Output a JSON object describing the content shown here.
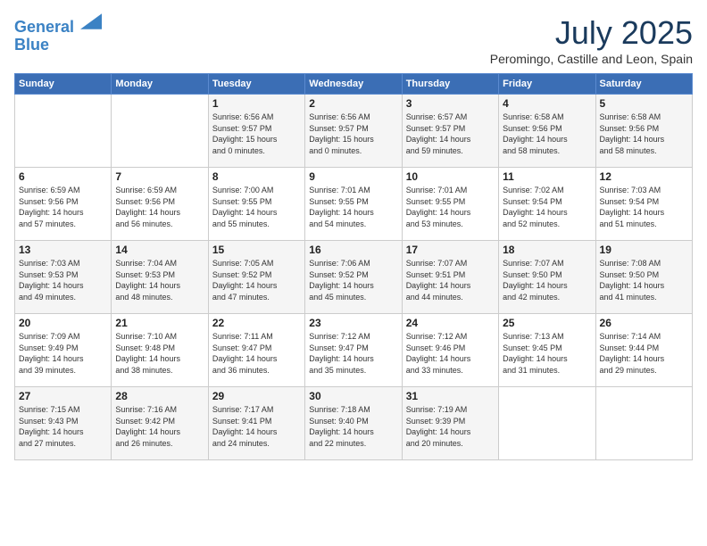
{
  "logo": {
    "line1": "General",
    "line2": "Blue"
  },
  "title": "July 2025",
  "location": "Peromingo, Castille and Leon, Spain",
  "days_of_week": [
    "Sunday",
    "Monday",
    "Tuesday",
    "Wednesday",
    "Thursday",
    "Friday",
    "Saturday"
  ],
  "weeks": [
    [
      {
        "day": "",
        "info": ""
      },
      {
        "day": "",
        "info": ""
      },
      {
        "day": "1",
        "info": "Sunrise: 6:56 AM\nSunset: 9:57 PM\nDaylight: 15 hours\nand 0 minutes."
      },
      {
        "day": "2",
        "info": "Sunrise: 6:56 AM\nSunset: 9:57 PM\nDaylight: 15 hours\nand 0 minutes."
      },
      {
        "day": "3",
        "info": "Sunrise: 6:57 AM\nSunset: 9:57 PM\nDaylight: 14 hours\nand 59 minutes."
      },
      {
        "day": "4",
        "info": "Sunrise: 6:58 AM\nSunset: 9:56 PM\nDaylight: 14 hours\nand 58 minutes."
      },
      {
        "day": "5",
        "info": "Sunrise: 6:58 AM\nSunset: 9:56 PM\nDaylight: 14 hours\nand 58 minutes."
      }
    ],
    [
      {
        "day": "6",
        "info": "Sunrise: 6:59 AM\nSunset: 9:56 PM\nDaylight: 14 hours\nand 57 minutes."
      },
      {
        "day": "7",
        "info": "Sunrise: 6:59 AM\nSunset: 9:56 PM\nDaylight: 14 hours\nand 56 minutes."
      },
      {
        "day": "8",
        "info": "Sunrise: 7:00 AM\nSunset: 9:55 PM\nDaylight: 14 hours\nand 55 minutes."
      },
      {
        "day": "9",
        "info": "Sunrise: 7:01 AM\nSunset: 9:55 PM\nDaylight: 14 hours\nand 54 minutes."
      },
      {
        "day": "10",
        "info": "Sunrise: 7:01 AM\nSunset: 9:55 PM\nDaylight: 14 hours\nand 53 minutes."
      },
      {
        "day": "11",
        "info": "Sunrise: 7:02 AM\nSunset: 9:54 PM\nDaylight: 14 hours\nand 52 minutes."
      },
      {
        "day": "12",
        "info": "Sunrise: 7:03 AM\nSunset: 9:54 PM\nDaylight: 14 hours\nand 51 minutes."
      }
    ],
    [
      {
        "day": "13",
        "info": "Sunrise: 7:03 AM\nSunset: 9:53 PM\nDaylight: 14 hours\nand 49 minutes."
      },
      {
        "day": "14",
        "info": "Sunrise: 7:04 AM\nSunset: 9:53 PM\nDaylight: 14 hours\nand 48 minutes."
      },
      {
        "day": "15",
        "info": "Sunrise: 7:05 AM\nSunset: 9:52 PM\nDaylight: 14 hours\nand 47 minutes."
      },
      {
        "day": "16",
        "info": "Sunrise: 7:06 AM\nSunset: 9:52 PM\nDaylight: 14 hours\nand 45 minutes."
      },
      {
        "day": "17",
        "info": "Sunrise: 7:07 AM\nSunset: 9:51 PM\nDaylight: 14 hours\nand 44 minutes."
      },
      {
        "day": "18",
        "info": "Sunrise: 7:07 AM\nSunset: 9:50 PM\nDaylight: 14 hours\nand 42 minutes."
      },
      {
        "day": "19",
        "info": "Sunrise: 7:08 AM\nSunset: 9:50 PM\nDaylight: 14 hours\nand 41 minutes."
      }
    ],
    [
      {
        "day": "20",
        "info": "Sunrise: 7:09 AM\nSunset: 9:49 PM\nDaylight: 14 hours\nand 39 minutes."
      },
      {
        "day": "21",
        "info": "Sunrise: 7:10 AM\nSunset: 9:48 PM\nDaylight: 14 hours\nand 38 minutes."
      },
      {
        "day": "22",
        "info": "Sunrise: 7:11 AM\nSunset: 9:47 PM\nDaylight: 14 hours\nand 36 minutes."
      },
      {
        "day": "23",
        "info": "Sunrise: 7:12 AM\nSunset: 9:47 PM\nDaylight: 14 hours\nand 35 minutes."
      },
      {
        "day": "24",
        "info": "Sunrise: 7:12 AM\nSunset: 9:46 PM\nDaylight: 14 hours\nand 33 minutes."
      },
      {
        "day": "25",
        "info": "Sunrise: 7:13 AM\nSunset: 9:45 PM\nDaylight: 14 hours\nand 31 minutes."
      },
      {
        "day": "26",
        "info": "Sunrise: 7:14 AM\nSunset: 9:44 PM\nDaylight: 14 hours\nand 29 minutes."
      }
    ],
    [
      {
        "day": "27",
        "info": "Sunrise: 7:15 AM\nSunset: 9:43 PM\nDaylight: 14 hours\nand 27 minutes."
      },
      {
        "day": "28",
        "info": "Sunrise: 7:16 AM\nSunset: 9:42 PM\nDaylight: 14 hours\nand 26 minutes."
      },
      {
        "day": "29",
        "info": "Sunrise: 7:17 AM\nSunset: 9:41 PM\nDaylight: 14 hours\nand 24 minutes."
      },
      {
        "day": "30",
        "info": "Sunrise: 7:18 AM\nSunset: 9:40 PM\nDaylight: 14 hours\nand 22 minutes."
      },
      {
        "day": "31",
        "info": "Sunrise: 7:19 AM\nSunset: 9:39 PM\nDaylight: 14 hours\nand 20 minutes."
      },
      {
        "day": "",
        "info": ""
      },
      {
        "day": "",
        "info": ""
      }
    ]
  ]
}
